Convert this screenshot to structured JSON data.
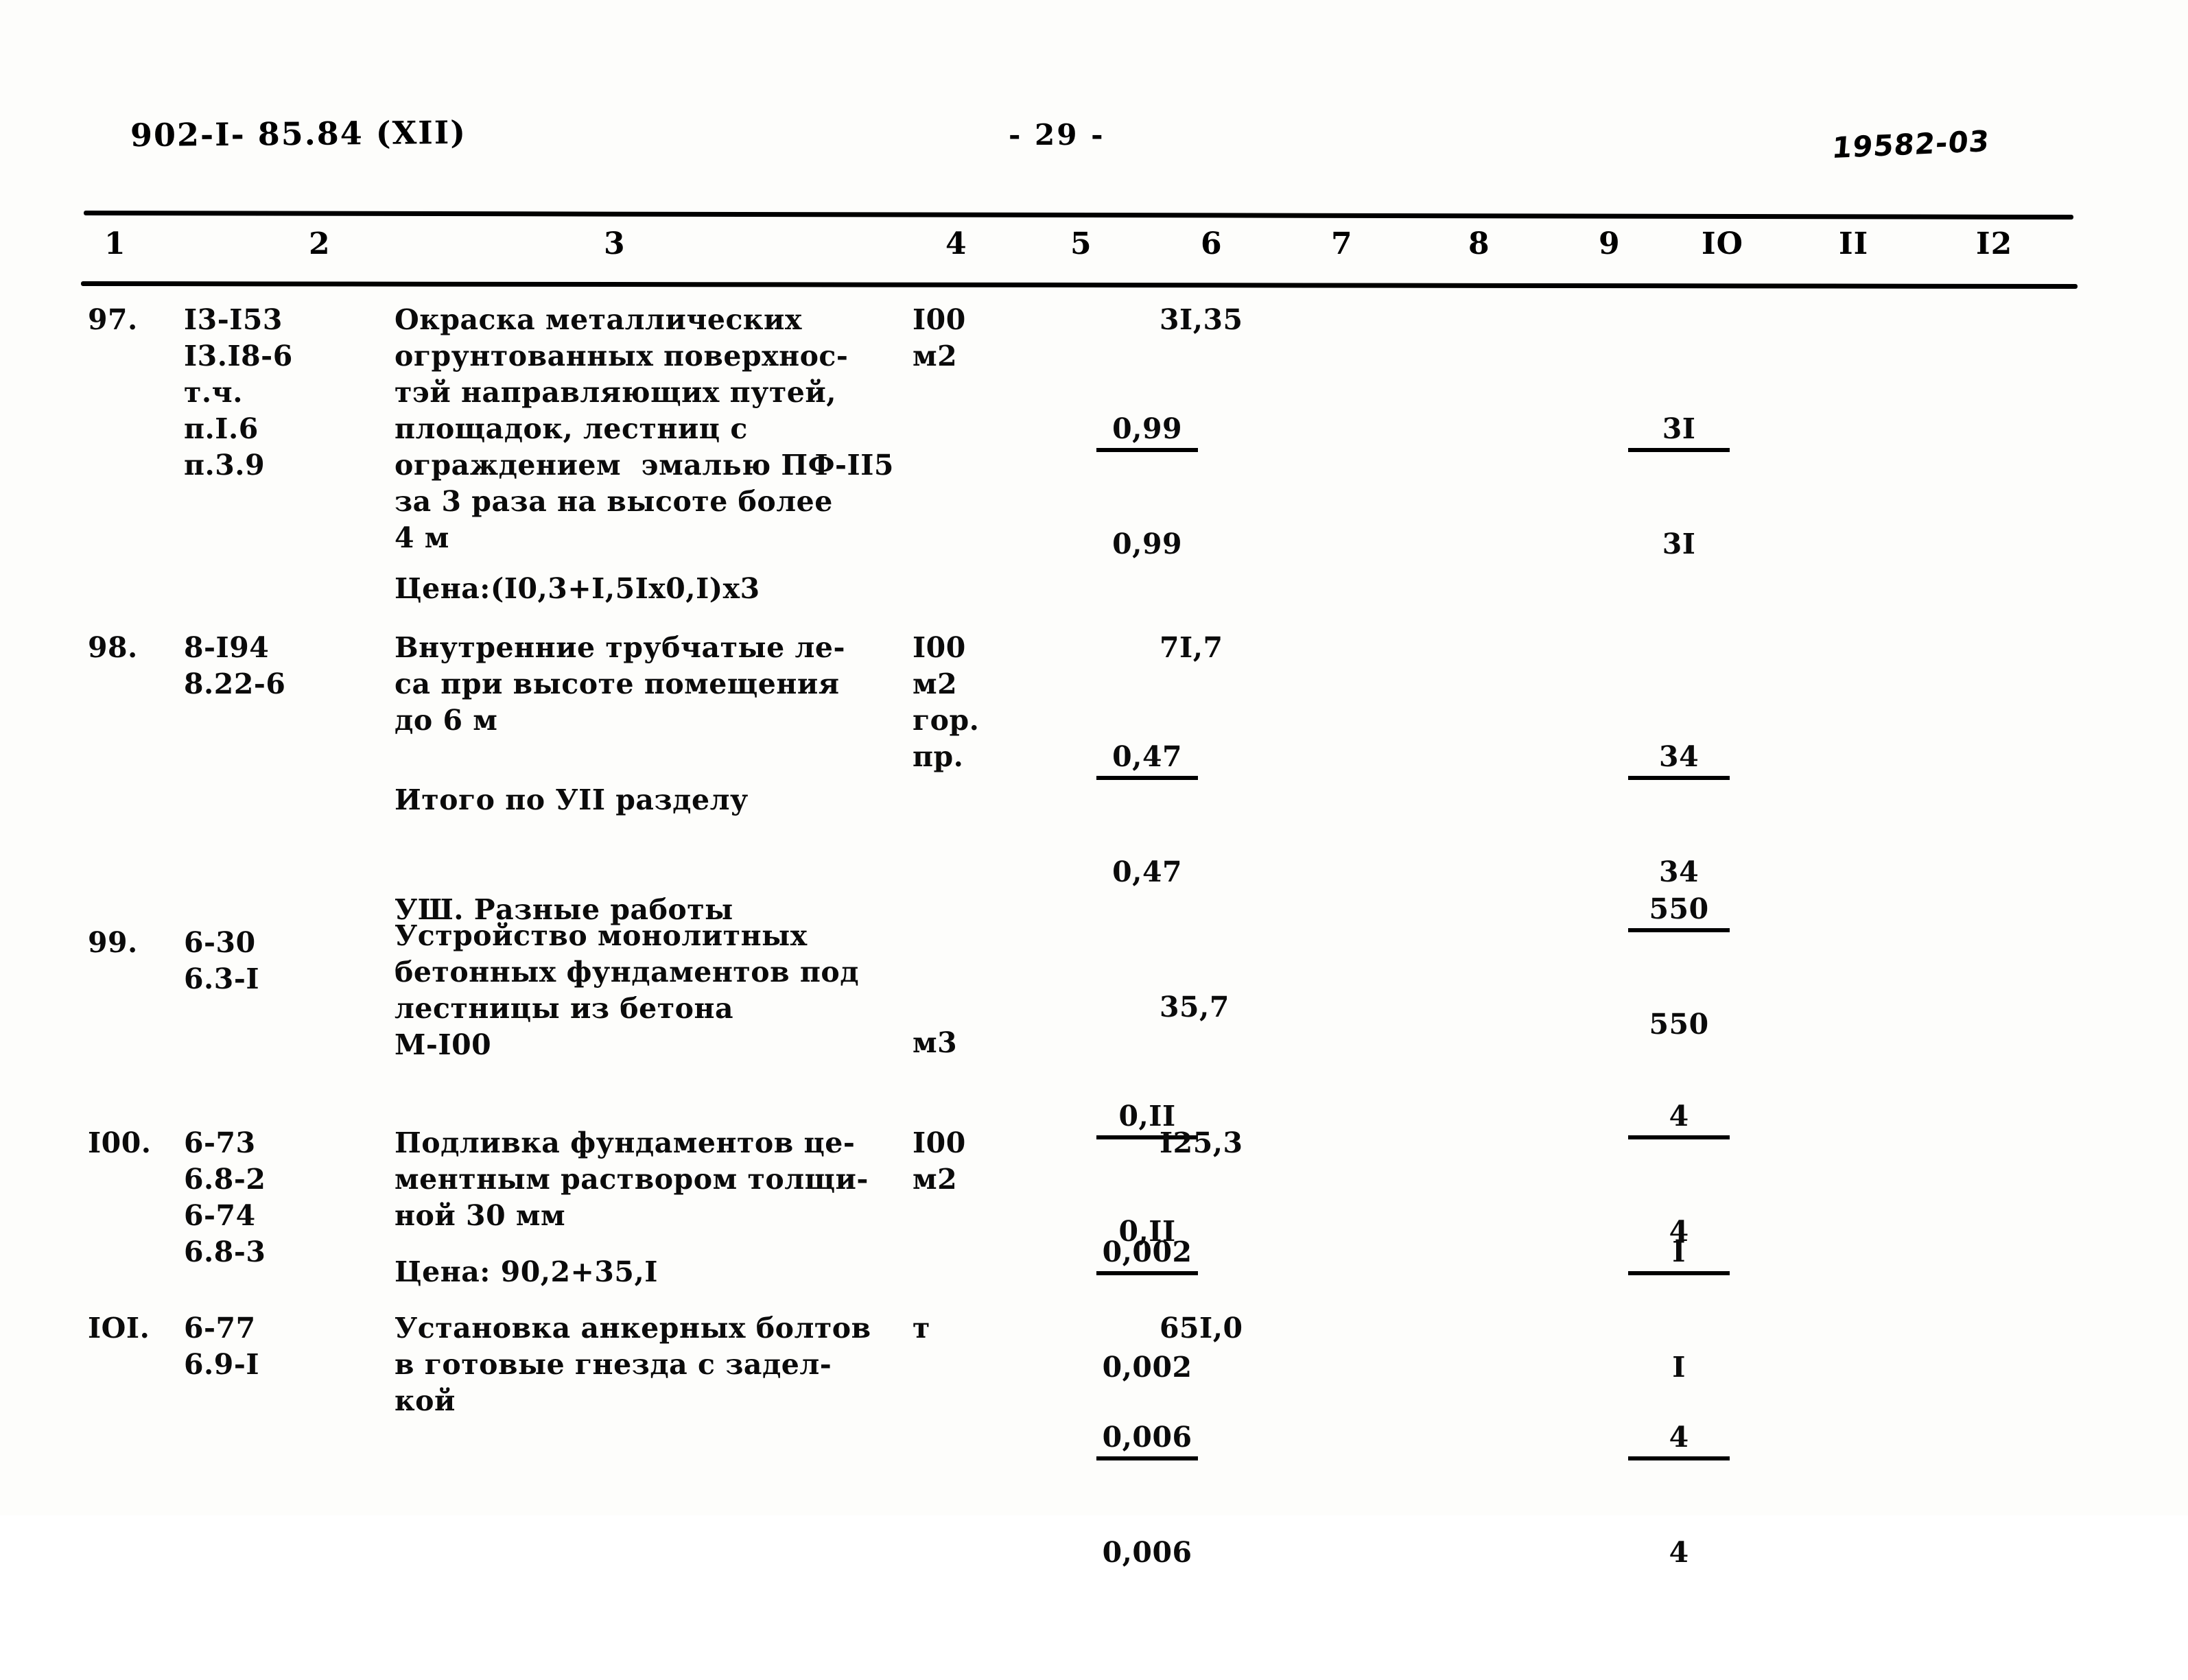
{
  "header": {
    "doc_code": "902-I- 85.84  (XII)",
    "page_number": "- 29 -",
    "sheet_code": "19582-03"
  },
  "table": {
    "column_headers": [
      "1",
      "2",
      "3",
      "4",
      "5",
      "6",
      "7",
      "8",
      "9",
      "IO",
      "II",
      "I2"
    ],
    "rows": [
      {
        "num": "97.",
        "codes": "I3-I53\nI3.I8-6\nт.ч.\nп.I.6\nп.3.9",
        "description": "Окраска металлических\nогрунтованных поверхнос-\nтэй направляющих путей,\nплощадок, лестниц с\nограждением  эмалью ПФ-II5\nза 3 раза на высоте более\n4 м",
        "price_note": "Цена:(I0,3+I,5Iх0,I)х3",
        "unit": "I00\nм2",
        "col5_top": "0,99",
        "col5_bottom": "0,99",
        "col6": "3I,35",
        "col9_top": "3I",
        "col9_bottom": "3I"
      },
      {
        "num": "98.",
        "codes": "8-I94\n8.22-6",
        "description": "Внутренние трубчатые ле-\nса при высоте помещения\nдо 6 м",
        "price_note": "",
        "unit": "I00\nм2\nгор.\nпр.",
        "col5_top": "0,47",
        "col5_bottom": "0,47",
        "col6": "7I,7",
        "col9_top": "34",
        "col9_bottom": "34"
      },
      {
        "num": "",
        "codes": "",
        "description": "Итого по УII разделу",
        "price_note": "",
        "unit": "",
        "col5_top": "",
        "col5_bottom": "",
        "col6": "",
        "col9_top": "550",
        "col9_bottom": "550"
      },
      {
        "num": "99.",
        "codes": "6-30\n6.3-I",
        "description": "Устройство монолитных\nбетонных фундаментов под\nлестницы из бетона\nМ-I00",
        "price_note": "",
        "unit": "м3",
        "col5_top": "0,II",
        "col5_bottom": "0,II",
        "col6": "35,7",
        "col9_top": "4",
        "col9_bottom": "4"
      },
      {
        "num": "I00.",
        "codes": "6-73\n6.8-2\n6-74\n6.8-3",
        "description": "Подливка фундаментов це-\nментным раствором толщи-\nной 30 мм",
        "price_note": "Цена: 90,2+35,I",
        "unit": "I00\nм2",
        "col5_top": "0,002",
        "col5_bottom": "0,002",
        "col6": "I25,3",
        "col9_top": "I",
        "col9_bottom": "I"
      },
      {
        "num": "IOI.",
        "codes": "6-77\n6.9-I",
        "description": "Установка анкерных болтов\nв готовые гнезда с задел-\nкой",
        "price_note": "",
        "unit": "т",
        "col5_top": "0,006",
        "col5_bottom": "0,006",
        "col6": "65I,0",
        "col9_top": "4",
        "col9_bottom": "4"
      }
    ],
    "section_heading": "УШ. Разные работы"
  }
}
